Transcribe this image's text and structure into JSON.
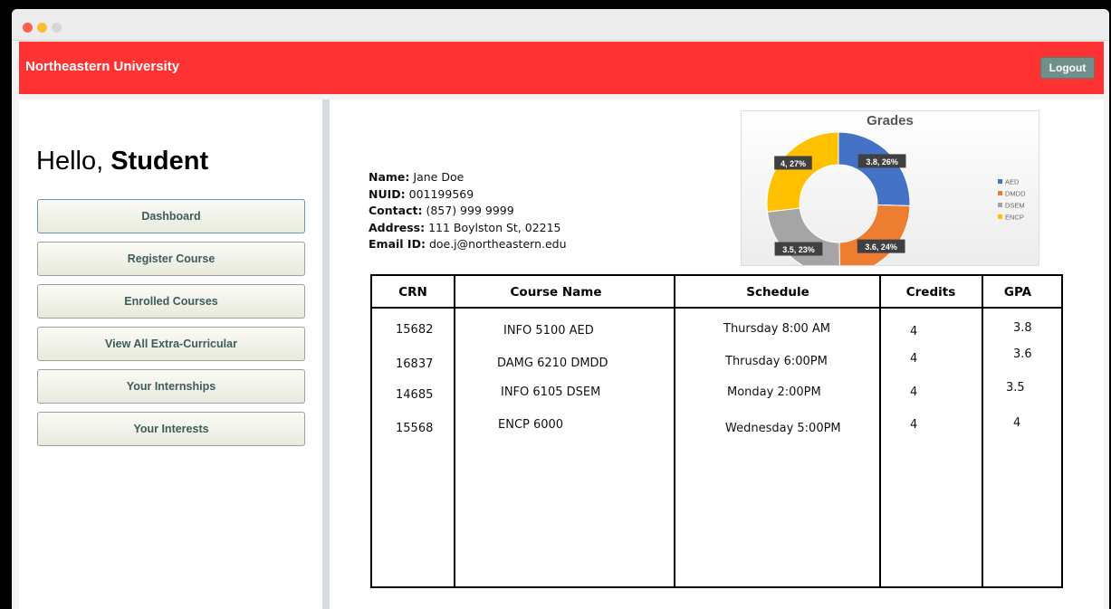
{
  "app": {
    "brand": "Northeastern University",
    "logout_label": "Logout"
  },
  "greeting": {
    "hello": "Hello,",
    "role": "Student"
  },
  "nav": [
    {
      "label": "Dashboard",
      "active": true
    },
    {
      "label": "Register Course"
    },
    {
      "label": "Enrolled Courses"
    },
    {
      "label": "View All Extra-Curricular"
    },
    {
      "label": "Your Internships"
    },
    {
      "label": "Your Interests"
    }
  ],
  "profile": {
    "name_label": "Name:",
    "name": "Jane Doe",
    "nuid_label": "NUID:",
    "nuid": "001199569",
    "contact_label": "Contact:",
    "contact": "(857) 999 9999",
    "address_label": "Address:",
    "address": "111 Boylston St, 02215",
    "email_label": "Email ID:",
    "email": "doe.j@northeastern.edu"
  },
  "chart_data": {
    "type": "pie",
    "title": "Grades",
    "categories": [
      "AED",
      "DMDD",
      "DSEM",
      "ENCP"
    ],
    "values": [
      3.8,
      3.6,
      3.5,
      4
    ],
    "labels": [
      "3.8, 26%",
      "3.6, 24%",
      "3.5, 23%",
      "4, 27%"
    ],
    "colors": [
      "#4472c4",
      "#ed7d31",
      "#a5a5a5",
      "#ffc000"
    ],
    "legend_position": "right",
    "donut": true
  },
  "table": {
    "headers": [
      "CRN",
      "Course Name",
      "Schedule",
      "Credits",
      "GPA"
    ],
    "rows": [
      [
        "15682",
        "INFO 5100 AED",
        "Thursday 8:00 AM",
        "4",
        "3.8"
      ],
      [
        "16837",
        "DAMG 6210 DMDD",
        "Thrusday 6:00PM",
        "4",
        "3.6"
      ],
      [
        "14685",
        "INFO 6105 DSEM",
        "Monday 2:00PM",
        "4",
        "3.5"
      ],
      [
        "15568",
        "ENCP 6000",
        "Wednesday 5:00PM",
        "4",
        "4"
      ]
    ]
  }
}
